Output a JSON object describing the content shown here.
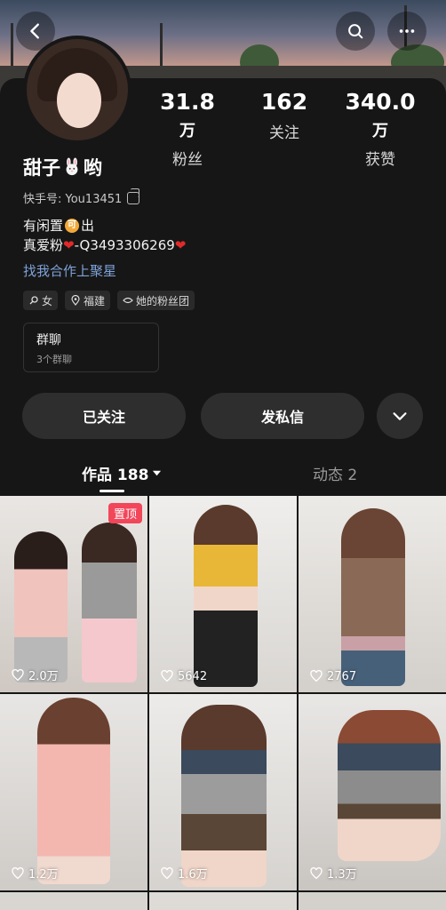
{
  "header": {
    "back_icon": "chevron-left-icon",
    "search_icon": "search-icon",
    "more_icon": "more-dots-icon"
  },
  "profile": {
    "name_prefix": "甜子",
    "name_suffix": "哟",
    "kuaishou_id": "快手号: You13451",
    "stats": [
      {
        "num": "31.8",
        "unit": "万",
        "label": "粉丝"
      },
      {
        "num": "162",
        "unit": "",
        "label": "关注"
      },
      {
        "num": "340.0",
        "unit": "万",
        "label": "获赞"
      }
    ],
    "bio_line1_a": "有闲置",
    "bio_line1_coin": "可",
    "bio_line1_b": "出",
    "bio_line2_a": "真爱粉",
    "bio_line2_b": "-Q3493306269",
    "link": "找我合作上聚星",
    "tags": [
      "女",
      "福建",
      "她的粉丝团"
    ],
    "group_title": "群聊",
    "group_sub": "3个群聊"
  },
  "actions": {
    "follow_label": "已关注",
    "message_label": "发私信"
  },
  "tabs": {
    "works_label": "作品 188",
    "dynamic_label": "动态 2"
  },
  "posts": [
    {
      "likes": "2.0万",
      "pinned": "置顶"
    },
    {
      "likes": "5642"
    },
    {
      "likes": "2767"
    },
    {
      "likes": "1.2万"
    },
    {
      "likes": "1.6万"
    },
    {
      "likes": "1.3万"
    }
  ],
  "colors": {
    "background": "#161616",
    "button": "#2e2e2e",
    "link": "#7fa2d8",
    "pin": "#f2465a"
  }
}
